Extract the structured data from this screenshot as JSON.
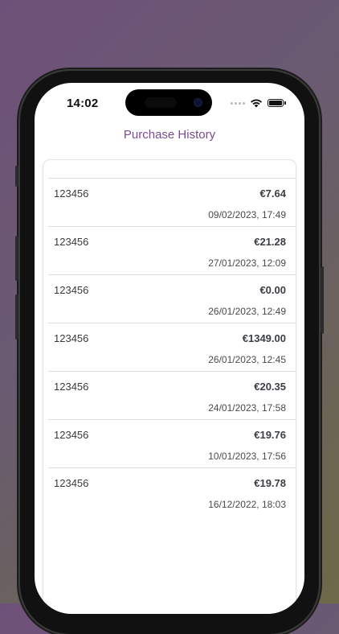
{
  "status_bar": {
    "time": "14:02",
    "icons": [
      "signal-dots-icon",
      "wifi-icon",
      "battery-icon"
    ]
  },
  "header": {
    "title": "Purchase History"
  },
  "purchases": [
    {
      "id": "123456",
      "amount": "€7.64",
      "date": "09/02/2023, 17:49"
    },
    {
      "id": "123456",
      "amount": "€21.28",
      "date": "27/01/2023, 12:09"
    },
    {
      "id": "123456",
      "amount": "€0.00",
      "date": "26/01/2023, 12:49"
    },
    {
      "id": "123456",
      "amount": "€1349.00",
      "date": "26/01/2023, 12:45"
    },
    {
      "id": "123456",
      "amount": "€20.35",
      "date": "24/01/2023, 17:58"
    },
    {
      "id": "123456",
      "amount": "€19.76",
      "date": "10/01/2023, 17:56"
    },
    {
      "id": "123456",
      "amount": "€19.78",
      "date": "16/12/2022, 18:03"
    }
  ],
  "colors": {
    "title": "#7a4c8f",
    "amount": "#3b3e44",
    "divider": "#dcdcdc"
  }
}
